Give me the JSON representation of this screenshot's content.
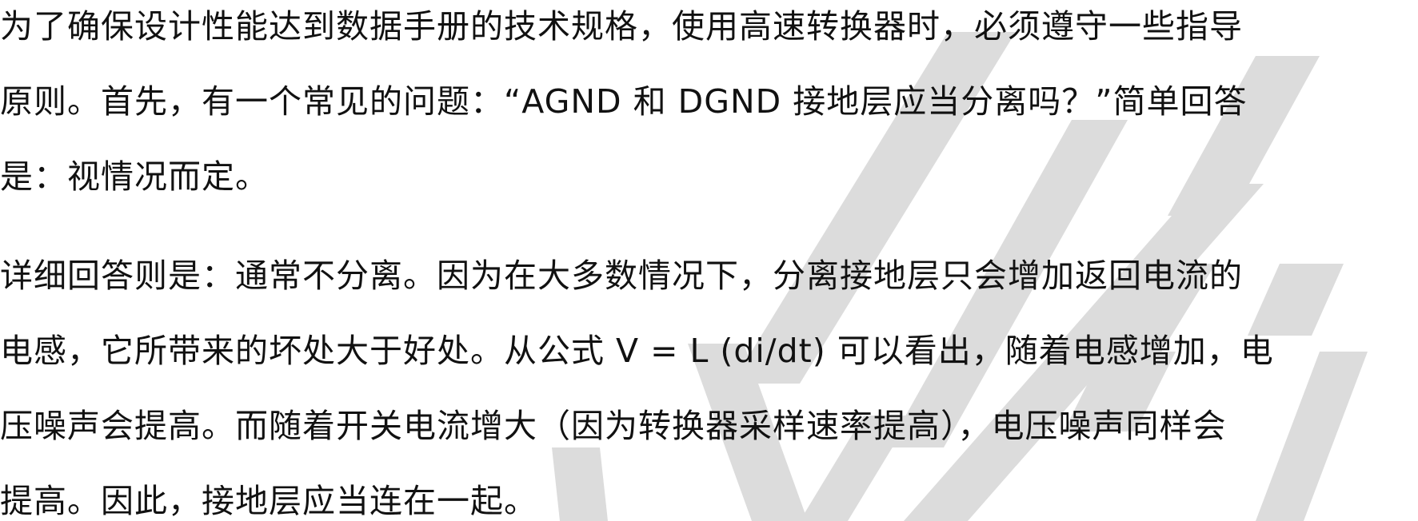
{
  "document": {
    "paragraphs": [
      {
        "lines": [
          "为了确保设计性能达到数据手册的技术规格，使用高速转换器时，必须遵守一些指导",
          "原则。首先，有一个常见的问题：“AGND 和 DGND 接地层应当分离吗？”简单回答",
          "是：视情况而定。"
        ]
      },
      {
        "lines": [
          "详细回答则是：通常不分离。因为在大多数情况下，分离接地层只会增加返回电流的",
          "电感，它所带来的坏处大于好处。从公式 V = L (di/dt) 可以看出，随着电感增加，电",
          "压噪声会提高。而随着开关电流增大（因为转换器采样速率提高），电压噪声同样会",
          "提高。因此，接地层应当连在一起。"
        ]
      }
    ]
  },
  "colors": {
    "text": "#111111",
    "watermark": "#dcdcdc",
    "background": "#ffffff"
  }
}
